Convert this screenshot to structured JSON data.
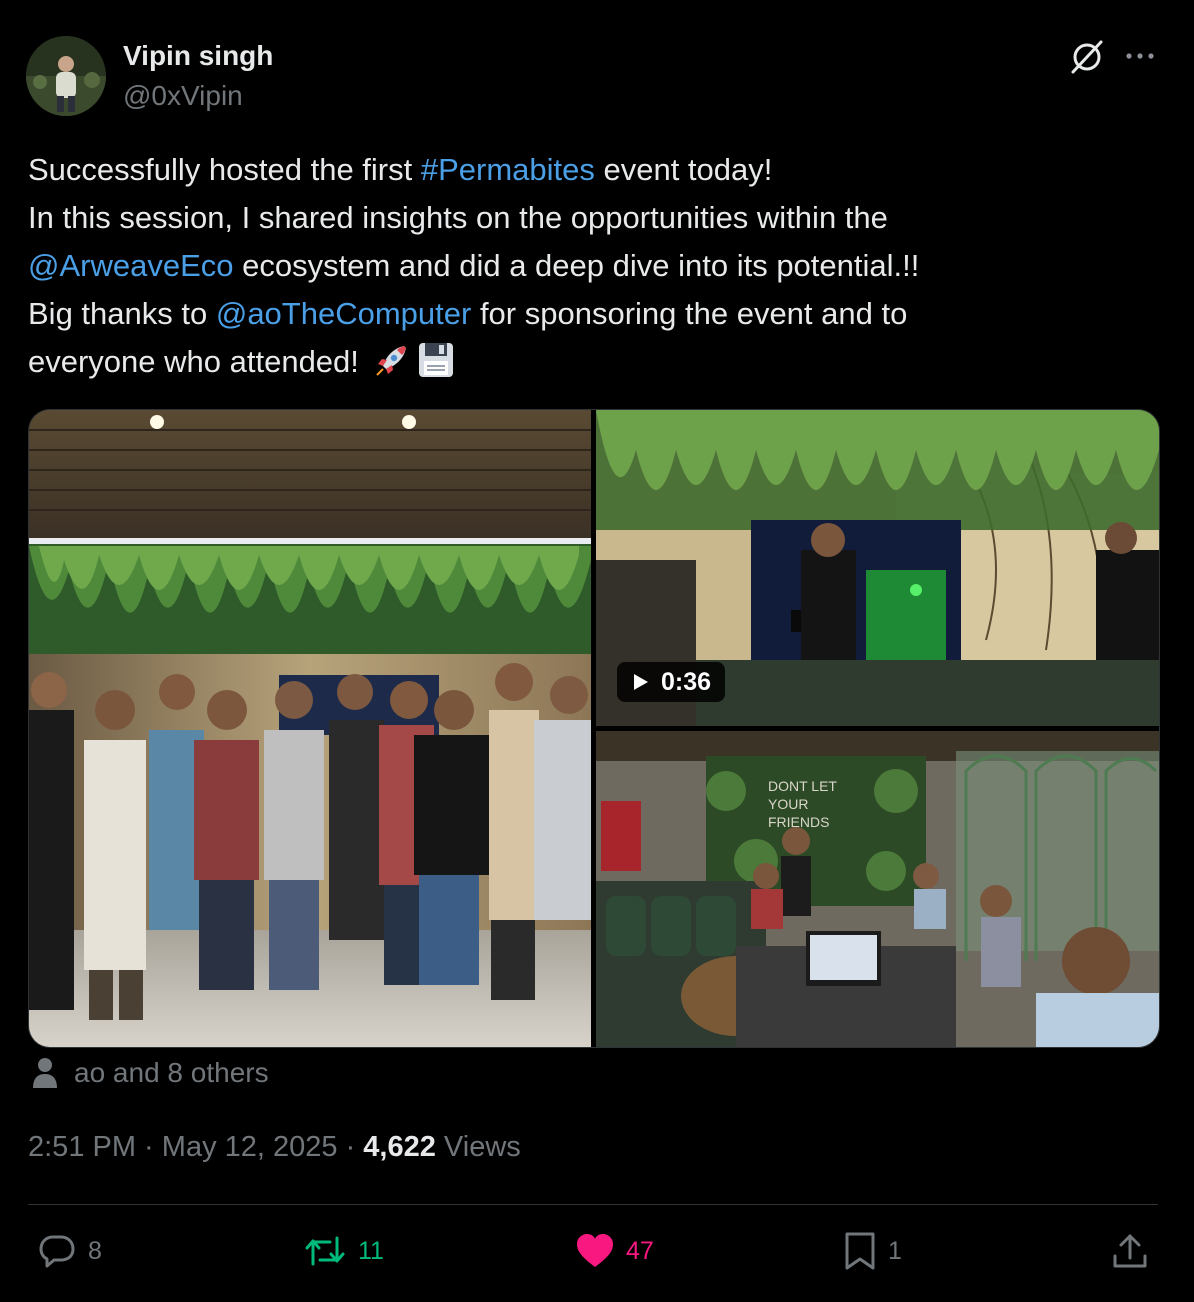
{
  "author": {
    "display_name": "Vipin singh",
    "handle": "@0xVipin"
  },
  "icons": {
    "grok": "grok-icon",
    "more": "more-icon",
    "play": "play-icon",
    "person": "person-icon",
    "reply": "reply-icon",
    "repost": "repost-icon",
    "like": "heart-icon",
    "bookmark": "bookmark-icon",
    "share": "share-icon"
  },
  "tweet": {
    "l1_a": "Successfully hosted the first ",
    "l1_hashtag": "#Permabites",
    "l1_b": " event today!",
    "l2": "In this session, I shared insights on the opportunities within the",
    "l3_mention": "@ArweaveEco",
    "l3_b": "  ecosystem and did a deep dive into its potential.!!",
    "l4_a": "Big thanks to ",
    "l4_mention": "@aoTheComputer",
    "l4_b": "  for sponsoring the event and to",
    "l5": "everyone who attended! ",
    "emojis": [
      "rocket-emoji",
      "floppy-disk-emoji"
    ]
  },
  "media": {
    "video_duration": "0:36",
    "photo_text": "DONT LET YOUR FRIENDS DRINK ALONE"
  },
  "tagged": {
    "text": "ao and 8 others"
  },
  "meta": {
    "time": "2:51 PM",
    "sep1": " · ",
    "date": "May 12, 2025",
    "sep2": " · ",
    "views_count": "4,622",
    "views_label": " Views"
  },
  "actions": {
    "replies": "8",
    "reposts": "11",
    "likes": "47",
    "bookmarks": "1"
  },
  "colors": {
    "background": "#000000",
    "text": "#e7e9ea",
    "muted": "#71767b",
    "link": "#4a9fe6",
    "repost": "#00ba7c",
    "like": "#f91880",
    "divider": "#2f3336"
  }
}
